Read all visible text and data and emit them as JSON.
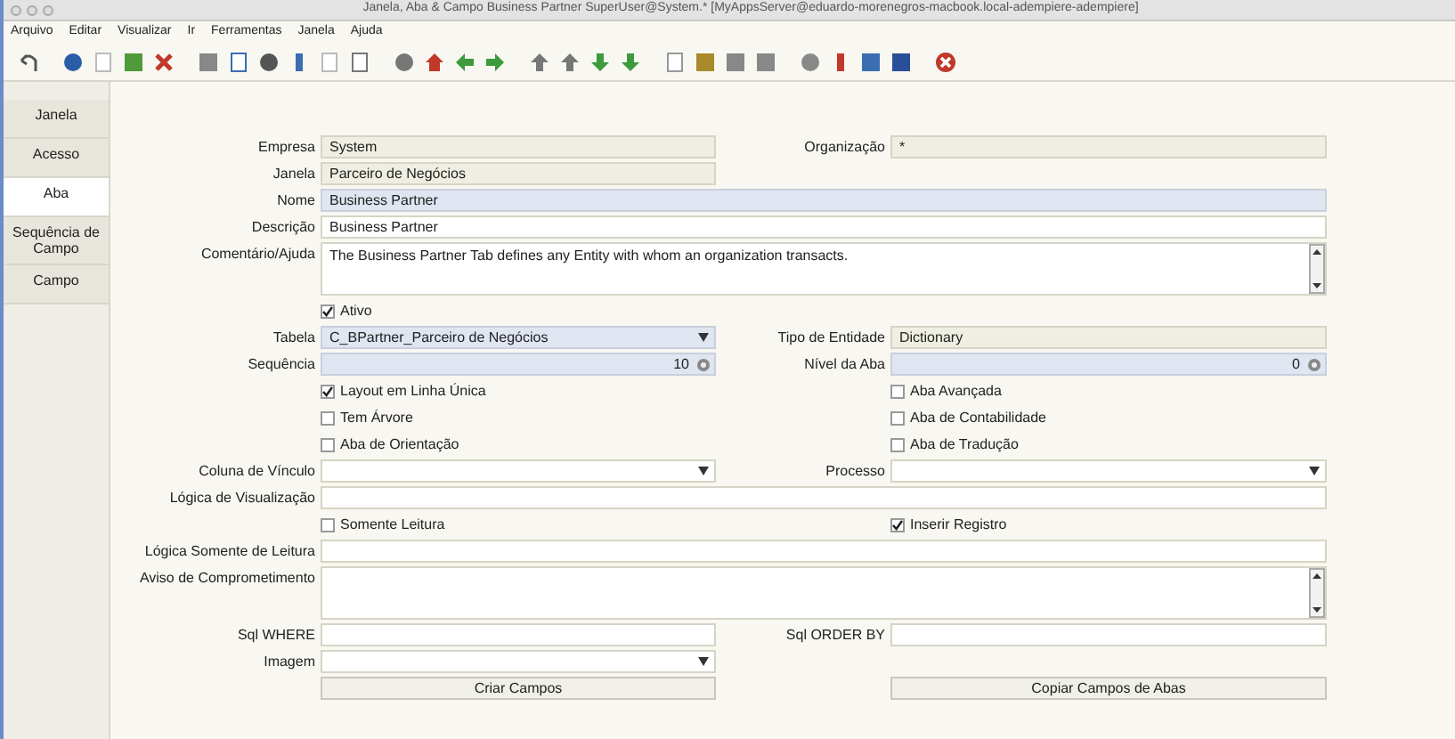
{
  "window": {
    "title": "Janela, Aba & Campo  Business Partner  SuperUser@System.* [MyAppsServer@eduardo-morenegros-macbook.local-adempiere-adempiere]"
  },
  "menu": [
    "Arquivo",
    "Editar",
    "Visualizar",
    "Ir",
    "Ferramentas",
    "Janela",
    "Ajuda"
  ],
  "tabs": [
    {
      "label": "Janela",
      "selected": false
    },
    {
      "label": "Acesso",
      "selected": false
    },
    {
      "label": "Aba",
      "selected": true
    },
    {
      "label": "Sequência de Campo",
      "selected": false
    },
    {
      "label": "Campo",
      "selected": false
    }
  ],
  "form": [
    {
      "left": {
        "kind": "text",
        "label": "Empresa",
        "value": "System",
        "readonly": true,
        "mandatory": false
      },
      "right": {
        "kind": "text",
        "label": "Organização",
        "value": "*",
        "readonly": true,
        "mandatory": false
      }
    },
    {
      "left": {
        "kind": "text",
        "label": "Janela",
        "value": "Parceiro de Negócios",
        "readonly": true,
        "mandatory": false
      }
    },
    {
      "wide": {
        "kind": "text",
        "label": "Nome",
        "value": "Business Partner",
        "readonly": false,
        "mandatory": true
      }
    },
    {
      "wide": {
        "kind": "text",
        "label": "Descrição",
        "value": "Business Partner",
        "readonly": false,
        "mandatory": false
      }
    },
    {
      "wide": {
        "kind": "textarea",
        "label": "Comentário/Ajuda",
        "value": "The Business Partner Tab defines any Entity with whom an organization transacts.",
        "readonly": false,
        "mandatory": false
      }
    },
    {
      "left": {
        "kind": "checkbox",
        "label": "Ativo",
        "checked": true
      }
    },
    {
      "left": {
        "kind": "combo",
        "label": "Tabela",
        "value": "C_BPartner_Parceiro de Negócios",
        "readonly": false,
        "mandatory": true
      },
      "right": {
        "kind": "text",
        "label": "Tipo de Entidade",
        "value": "Dictionary",
        "readonly": true,
        "mandatory": false
      }
    },
    {
      "left": {
        "kind": "number",
        "label": "Sequência",
        "value": "10",
        "readonly": false,
        "mandatory": true
      },
      "right": {
        "kind": "number",
        "label": "Nível da Aba",
        "value": "0",
        "readonly": false,
        "mandatory": true
      }
    },
    {
      "left": {
        "kind": "checkbox",
        "label": "Layout em Linha Única",
        "checked": true
      },
      "right": {
        "kind": "checkbox",
        "label": "Aba Avançada",
        "checked": false
      }
    },
    {
      "left": {
        "kind": "checkbox",
        "label": "Tem Árvore",
        "checked": false
      },
      "right": {
        "kind": "checkbox",
        "label": "Aba de Contabilidade",
        "checked": false
      }
    },
    {
      "left": {
        "kind": "checkbox",
        "label": "Aba de Orientação",
        "checked": false
      },
      "right": {
        "kind": "checkbox",
        "label": "Aba de Tradução",
        "checked": false
      }
    },
    {
      "left": {
        "kind": "combo",
        "label": "Coluna de Vínculo",
        "readonly": false,
        "mandatory": false
      },
      "right": {
        "kind": "combo",
        "label": "Processo",
        "readonly": false,
        "mandatory": false
      }
    },
    {
      "wide": {
        "kind": "text",
        "label": "Lógica de Visualização",
        "readonly": false,
        "mandatory": false
      }
    },
    {
      "left": {
        "kind": "checkbox",
        "label": "Somente Leitura",
        "checked": false
      },
      "right": {
        "kind": "checkbox",
        "label": "Inserir Registro",
        "checked": true
      }
    },
    {
      "wide": {
        "kind": "text",
        "label": "Lógica Somente de Leitura",
        "readonly": false,
        "mandatory": false
      }
    },
    {
      "wide": {
        "kind": "textarea",
        "label": "Aviso de Comprometimento",
        "readonly": false,
        "mandatory": false
      }
    },
    {
      "left": {
        "kind": "text",
        "label": "Sql WHERE",
        "readonly": false,
        "mandatory": false
      },
      "right": {
        "kind": "text",
        "label": "Sql ORDER BY",
        "readonly": false,
        "mandatory": false
      }
    },
    {
      "left": {
        "kind": "combo",
        "label": "Imagem",
        "readonly": false,
        "mandatory": false
      }
    },
    {
      "left": {
        "kind": "button",
        "label": "Criar Campos"
      },
      "right": {
        "kind": "button",
        "label": "Copiar Campos de Abas"
      }
    }
  ]
}
